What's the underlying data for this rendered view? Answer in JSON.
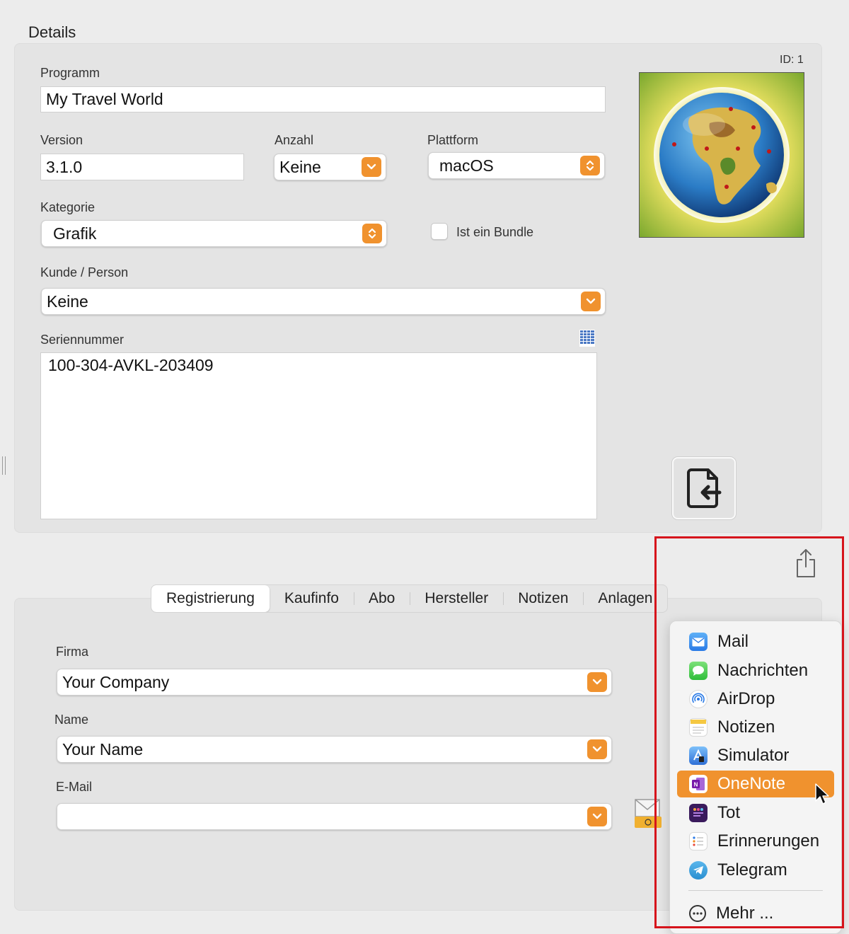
{
  "details": {
    "title": "Details",
    "id_label": "ID: 1",
    "program": {
      "label": "Programm",
      "value": "My Travel World"
    },
    "version": {
      "label": "Version",
      "value": "3.1.0"
    },
    "count": {
      "label": "Anzahl",
      "value": "Keine"
    },
    "platform": {
      "label": "Plattform",
      "value": "macOS"
    },
    "category": {
      "label": "Kategorie",
      "value": "Grafik"
    },
    "bundle": {
      "label": "Ist ein Bundle",
      "checked": false
    },
    "customer": {
      "label": "Kunde / Person",
      "value": "Keine"
    },
    "serial": {
      "label": "Seriennummer",
      "value": "100-304-AVKL-203409"
    }
  },
  "tabs": [
    {
      "label": "Registrierung",
      "active": true
    },
    {
      "label": "Kaufinfo",
      "active": false
    },
    {
      "label": "Abo",
      "active": false
    },
    {
      "label": "Hersteller",
      "active": false
    },
    {
      "label": "Notizen",
      "active": false
    },
    {
      "label": "Anlagen",
      "active": false
    }
  ],
  "registration": {
    "company": {
      "label": "Firma",
      "value": "Your Company"
    },
    "name": {
      "label": "Name",
      "value": "Your Name"
    },
    "email": {
      "label": "E-Mail",
      "value": ""
    }
  },
  "share_menu": {
    "items": [
      {
        "label": "Mail",
        "icon": "mail-icon"
      },
      {
        "label": "Nachrichten",
        "icon": "messages-icon"
      },
      {
        "label": "AirDrop",
        "icon": "airdrop-icon"
      },
      {
        "label": "Notizen",
        "icon": "notes-icon"
      },
      {
        "label": "Simulator",
        "icon": "simulator-icon"
      },
      {
        "label": "OneNote",
        "icon": "onenote-icon",
        "highlighted": true
      },
      {
        "label": "Tot",
        "icon": "tot-icon"
      },
      {
        "label": "Erinnerungen",
        "icon": "reminders-icon"
      },
      {
        "label": "Telegram",
        "icon": "telegram-icon"
      }
    ],
    "more_label": "Mehr ..."
  },
  "colors": {
    "accent": "#f0922e",
    "highlight_box": "#d6141c"
  }
}
